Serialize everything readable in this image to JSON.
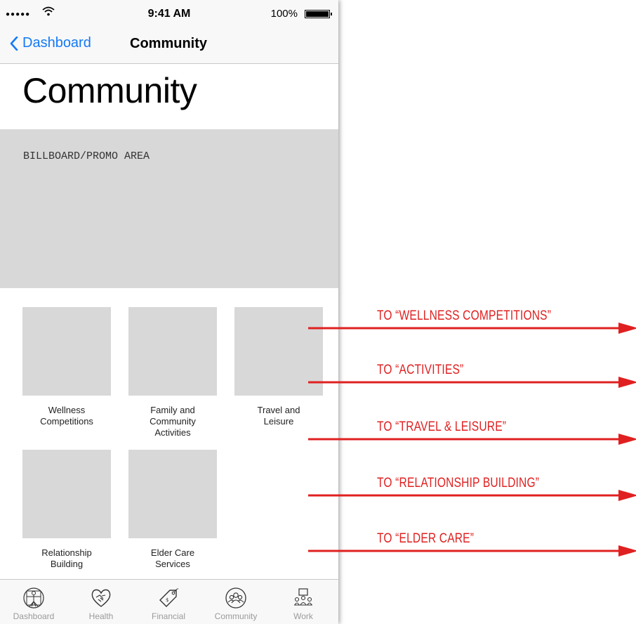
{
  "status_bar": {
    "signal": "●●●●●",
    "time": "9:41 AM",
    "battery": "100%"
  },
  "nav": {
    "back_label": "Dashboard",
    "title": "Community"
  },
  "page_title": "Community",
  "billboard": {
    "label": "BILLBOARD/PROMO AREA"
  },
  "tiles": [
    {
      "label": "Wellness\nCompetitions"
    },
    {
      "label": "Family and\nCommunity\nActivities"
    },
    {
      "label": "Travel and\nLeisure"
    },
    {
      "label": "Relationship\nBuilding"
    },
    {
      "label": "Elder Care\nServices"
    }
  ],
  "tabs": [
    {
      "label": "Dashboard",
      "icon": "vitruvian-icon"
    },
    {
      "label": "Health",
      "icon": "handshake-heart-icon"
    },
    {
      "label": "Financial",
      "icon": "price-tag-icon"
    },
    {
      "label": "Community",
      "icon": "group-icon"
    },
    {
      "label": "Work",
      "icon": "meeting-icon"
    }
  ],
  "annotations": [
    {
      "text": "TO “WELLNESS COMPETITIONS”"
    },
    {
      "text": "TO “ACTIVITIES”"
    },
    {
      "text": "TO “TRAVEL & LEISURE”"
    },
    {
      "text": "TO “RELATIONSHIP BUILDING”"
    },
    {
      "text": "TO “ELDER CARE”"
    }
  ],
  "colors": {
    "ios_blue": "#1479f7",
    "annotation_red": "#e02020",
    "placeholder_gray": "#d8d8d8"
  }
}
